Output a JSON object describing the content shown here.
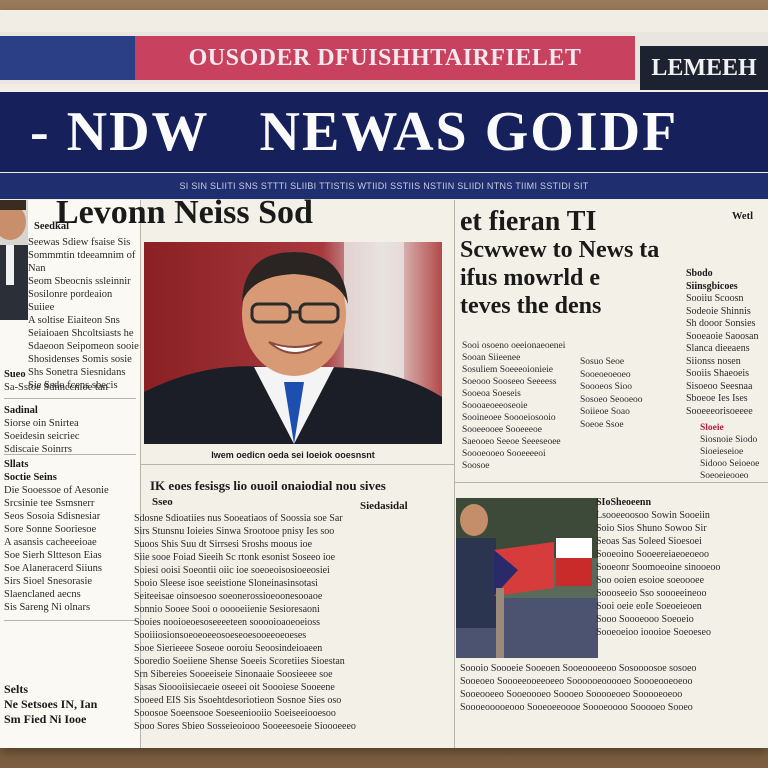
{
  "banner": {
    "red_text": "OUSODER DFUISHHTAIRFIELET",
    "dark_text": "LEMEEH"
  },
  "masthead": {
    "word1": "- NDW",
    "word2": "NEWAS GOIDF",
    "subline": "SI SIN SLIITI SNS STTTI SLIIBI TTISTIS WTIIDI SSTIIS NSTIIN SLIIDI NTNS TIIMI SSTIDI SIT"
  },
  "left_story": {
    "headline": "Levonn Neiss Sod",
    "intro_label": "Seedkal",
    "lines": [
      "Seewas Sdiew fsaise Sis",
      "Sommmtin tdeeamnim of Nan",
      "Seom Sbeocnis ssleinnir",
      "Sosilonre pordeaion Suiiee",
      "A soltise Eiaiteon Sns",
      "Seiaioaen Shcoltsiasts he",
      "Sdaeoon Seipomeon sooie",
      "Shosidenses Somis sosie",
      "Shs Sonetra Siesnidans",
      "Sie Ssdo fcens sbecis"
    ],
    "sub_label": "Sueo",
    "sub_line": "Sa-Sstoe Sdnnccnioe tan",
    "block2_label": "Sadinal",
    "block2_lines": [
      "Siorse oin Snirtea",
      "Soeidesin seicriec",
      "Sdiscaie Soinrrs"
    ],
    "block3_label": "Sllats",
    "block3_head": "Soctie Seins",
    "block3_lines": [
      "Die Sooessoe of Aesonie",
      "Srcsinie tee Ssmsnerr",
      "Seos Sosoia Sdisnesiar",
      "Sore Sonne Sooriesoe",
      "A asansis cacheeeioae",
      "Soe Sierh Sltteson Eias",
      "Soe Alaneracerd Siiuns",
      "Sirs Sioel Snesorasie",
      "Slaenclaned aecns",
      "Sis Sareng Ni olnars"
    ],
    "block4_label": "Selts",
    "block4_lines": [
      "Ne Setsoes IN, Ian",
      "Sm Fied Ni Iooe"
    ]
  },
  "center_story": {
    "photo_caption": "Iwem oedicn oeda sei Ioeiok ooesnsnt",
    "headline": "IK eoes fesisgs lio ouoil onaiodial nou sives",
    "byline_left": "Sseo",
    "byline_right": "Siedasidal",
    "lines": [
      "Sdosne Sdioatiies nus Sooeatiaos of Soossia soe Sar",
      "Sirs Stunsnu Ioieies Sinwa Srootooe pnisy Ies soo",
      "Suoos Shis Suu dt Sirrsesi Sroshs moous ioe",
      "Siie sooe Foiad Sieeih Sc rtonk esonist Soseeo ioe",
      "Soiesi ooisi Soeontii oiic ioe soeoeoisosioeeosiei",
      "Sooio Sleese isoe seeistione Sloneinasinsotasi",
      "Seiteeisae oinsoesoo soeonerossioeoonesooaoe",
      "Sonnio Sooee Sooi o ooooeiienie Sesioresaoni",
      "Sooies nooioeoesoseeeeteen sooooioaoeoeioss",
      "Sooiiiosionsoeoeoeeosoeseoesooeeoeoeses",
      "Sooe Sierieeee Soseoe ooroiu Seoosindeioaeen",
      "Sooredio Soeiiene Shense Soeeis Scoretiies Sioestan",
      "Srn Sibereies Sooeeiseie Sinonaaie Soosieeee soe",
      "Sasas Sioooiisiecaeie oseeei oit Soooiese Sooeene",
      "Sooeed EIS Sis Ssoehtdesoriotieon Sosnoe Sies oso",
      "Sooosoe Soeensooe Soeseeniooiio Soeiseeiooesoo",
      "Sooo Sores Sbieo Sosseieoiooo Sooeeesoeie Sioooeeeo"
    ]
  },
  "right_story": {
    "top_label": "Wetl",
    "headline_line1": "et fieran TI",
    "headline_line2": "Scwwew to News ta",
    "headline_line3": "ifus mowrld e",
    "headline_line4": "teves the dens",
    "side_label": "Sbodo",
    "side_head": "Siinsgbicoes",
    "side_lines": [
      "Sooiiu Scoosn",
      "Sodeoie Shinnis",
      "Sh dooor Sonsies",
      "Sooeaoie Saoosan",
      "Slanca dieeaens",
      "Siionss nosen",
      "Sooiis Shaeoeis",
      "Sisoeoo Seesnaa",
      "Sboeoe Ies Ises",
      "Sooeeeorisoeeee"
    ],
    "table_lines": [
      "Sooi osoeno oeeionaeoenei",
      "Sooan Siieenee",
      "Sosuliem Soeeeoionieie",
      "Soeooo Sooseeo Seeeess",
      "Sooeoa Soeseis",
      "Soooaeoeeoseoie",
      "Sooineoee Soooeiosooio",
      "Sooeeooee Sooeeeoe",
      "Saeooeo Seeoe Seeeseoee",
      "Soooeooeo Sooeeeeoi",
      "Soosoe"
    ],
    "right_table_lines": [
      "Sosuo Seoe",
      "Sooeoeoeoeo",
      "Soooeos Sioo",
      "Sosoeo Seooeoo",
      "Soiieoe Soao",
      "Soeoe Ssoe"
    ],
    "red_label": "Sloeie",
    "red_lines": [
      "Siosnoie Siodo",
      "Sioeieseioe",
      "Sidooo Seioeoe",
      "Soeoeieooeo"
    ],
    "photo2_label": "SIoSheoeenn",
    "photo2_lines": [
      "Lsooeeoosoo Sowin Sooeiin",
      "Soio Sios Shuno Sowoo Sir",
      "Seoas Sas Soleed Sioesoei",
      "Sooeoino Sooeereiaeoeoeoo",
      "Sooeonr Soomoeoine sinooeoo",
      "Soo ooien esoioe soeoooee",
      "Soooseeio Sso soooeeineoo",
      "Sooi oeie eoIe Soeoeieoen",
      "Sooo Soooeooo Soeoeio",
      "Sooeoeioo ioooioe Soeoeseo"
    ],
    "bottom_lines": [
      "Soooio Soooeie Sooeoen Sooeoooeeoo Sosoooosoe sosoeo",
      "Sooeoeo Soooeeooeeoeeo Soooooeooooeo Soooeooeoeoo",
      "Sooeooeeo Sooeoooeo Soooeo Sooooeoeo Sooooeoeoo",
      "Soooeooooeooo Sooeoeeoooe Soooeoooo Sooooeo Sooeo"
    ]
  },
  "colors": {
    "masthead_bg": "#16215c",
    "red_banner": "#c8425f",
    "blue_block": "#2a3f86",
    "paper": "#f1ede4"
  }
}
